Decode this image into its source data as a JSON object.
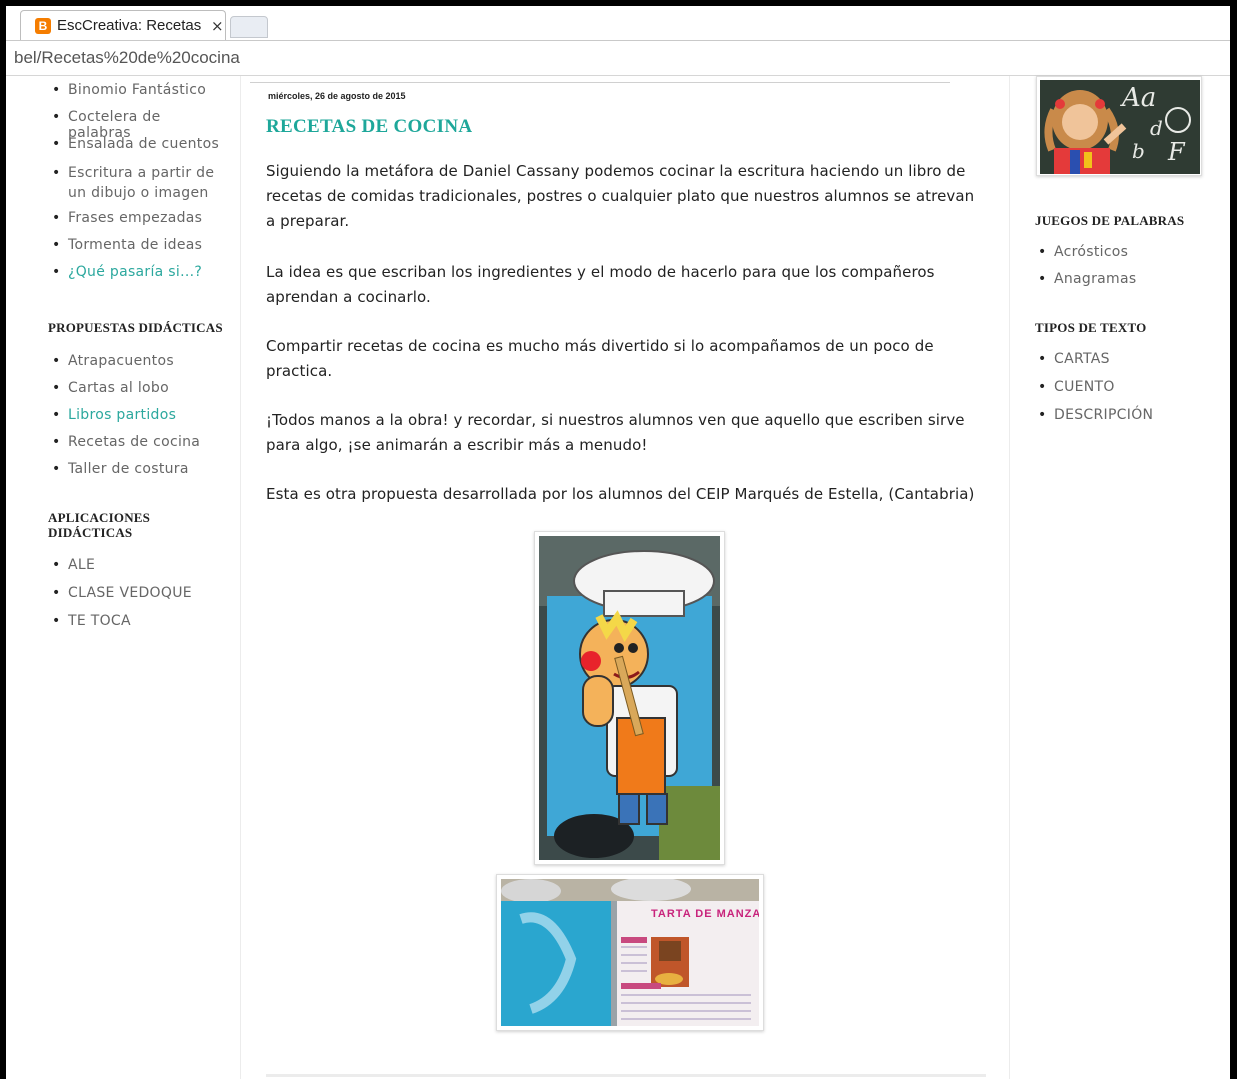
{
  "browser": {
    "tab_title": "EscCreativa: Recetas",
    "tab_close": "×",
    "favicon_letter": "B",
    "favicon_color": "#f57d00",
    "address": "bel/Recetas%20de%20cocina"
  },
  "sidebar_left": {
    "top_items": [
      {
        "label": "Binomio Fantástico"
      },
      {
        "label": "Coctelera de palabras"
      },
      {
        "label": "Ensalada de cuentos"
      },
      {
        "label": "Escritura a partir de un dibujo o imagen"
      },
      {
        "label": "Frases empezadas"
      },
      {
        "label": "Tormenta de ideas"
      },
      {
        "label": "¿Qué pasaría si...?"
      }
    ],
    "propuestas_title": "PROPUESTAS DIDÁCTICAS",
    "propuestas_items": [
      {
        "label": "Atrapacuentos"
      },
      {
        "label": "Cartas al lobo"
      },
      {
        "label": "Libros partidos"
      },
      {
        "label": "Recetas de cocina"
      },
      {
        "label": "Taller de costura"
      }
    ],
    "aplicaciones_title": "APLICACIONES DIDÁCTICAS",
    "aplicaciones_items": [
      {
        "label": "ALE"
      },
      {
        "label": "CLASE VEDOQUE"
      },
      {
        "label": "TE TOCA"
      }
    ]
  },
  "post": {
    "date": "miércoles, 26 de agosto de 2015",
    "title": "RECETAS DE COCINA",
    "paragraphs": [
      "Siguiendo la metáfora de Daniel Cassany podemos cocinar la escritura haciendo un libro de recetas de comidas tradicionales, postres o cualquier plato que nuestros alumnos se atrevan a preparar.",
      "La idea es que escriban los ingredientes y el modo de hacerlo para que los compañeros aprendan a cocinarlo.",
      "Compartir recetas de cocina es mucho más divertido si lo acompañamos de un poco de practica.",
      "¡Todos manos a la obra! y recordar, si nuestros alumnos ven que aquello que escriben sirve para algo, ¡se animarán a escribir más a menudo!",
      "Esta es otra propuesta desarrollada por los alumnos del CEIP Marqués de Estella, (Cantabria)"
    ],
    "photo2_heading": "TARTA DE MANZANA"
  },
  "sidebar_right": {
    "juegos_title": "JUEGOS DE PALABRAS",
    "juegos_items": [
      {
        "label": "Acrósticos"
      },
      {
        "label": "Anagramas"
      }
    ],
    "tipos_title": "TIPOS DE TEXTO",
    "tipos_items": [
      {
        "label": "CARTAS"
      },
      {
        "label": "CUENTO"
      },
      {
        "label": "DESCRIPCIÓN"
      }
    ]
  },
  "colors": {
    "accent_teal": "#1ea79a",
    "link_gray": "#666666"
  }
}
